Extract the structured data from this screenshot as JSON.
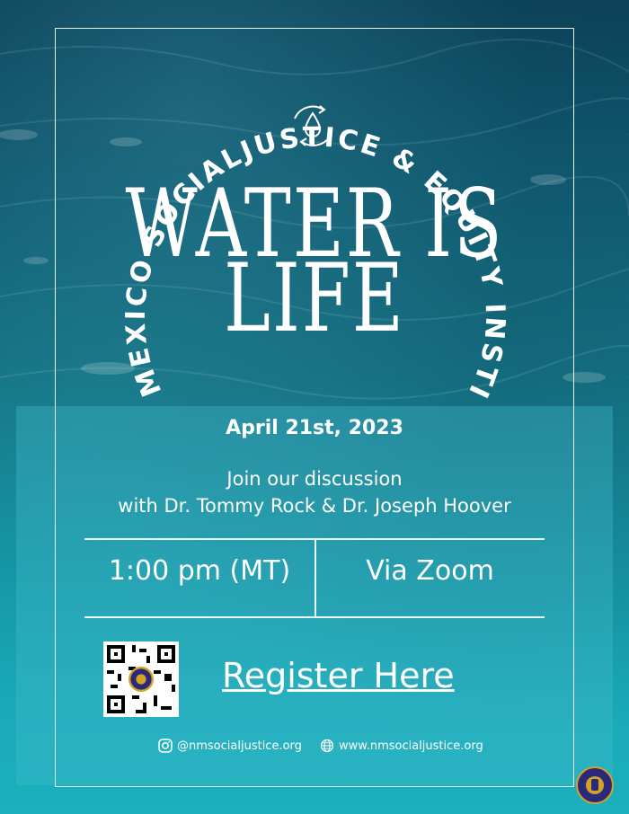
{
  "organization": "NEW MEXICO SOCIALJUSTICE & EQUITY INSTITUTE",
  "title": {
    "line1": "WATER IS",
    "line2": "LIFE"
  },
  "date": "April 21st, 2023",
  "description": {
    "line1": "Join our discussion",
    "line2": "with Dr. Tommy Rock & Dr. Joseph Hoover"
  },
  "time": "1:00 pm (MT)",
  "location": "Via Zoom",
  "register_label": "Register Here",
  "social": {
    "instagram": "@nmsocialjustice.org",
    "website": "www.nmsocialjustice.org"
  },
  "colors": {
    "water_dark": "#0b3f55",
    "water_light": "#1bb0bd",
    "badge_navy": "#2b2a7a",
    "badge_gold": "#d4a326"
  },
  "icons": {
    "header": "water-drop-cycle-icon",
    "instagram": "instagram-icon",
    "website": "globe-icon"
  }
}
